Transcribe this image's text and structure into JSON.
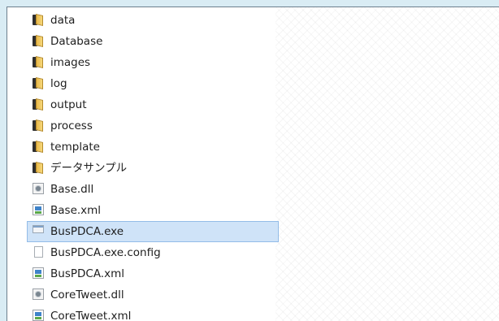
{
  "file_list": {
    "items": [
      {
        "name": "data",
        "type": "folder",
        "icon": "folder-icon"
      },
      {
        "name": "Database",
        "type": "folder",
        "icon": "folder-icon"
      },
      {
        "name": "images",
        "type": "folder",
        "icon": "folder-icon"
      },
      {
        "name": "log",
        "type": "folder",
        "icon": "folder-icon"
      },
      {
        "name": "output",
        "type": "folder",
        "icon": "folder-icon"
      },
      {
        "name": "process",
        "type": "folder",
        "icon": "folder-icon"
      },
      {
        "name": "template",
        "type": "folder",
        "icon": "folder-icon"
      },
      {
        "name": "データサンプル",
        "type": "folder",
        "icon": "folder-icon"
      },
      {
        "name": "Base.dll",
        "type": "dll",
        "icon": "dll-icon"
      },
      {
        "name": "Base.xml",
        "type": "xml",
        "icon": "xml-icon"
      },
      {
        "name": "BusPDCA.exe",
        "type": "exe",
        "icon": "exe-icon",
        "selected": true
      },
      {
        "name": "BusPDCA.exe.config",
        "type": "config",
        "icon": "file-icon"
      },
      {
        "name": "BusPDCA.xml",
        "type": "xml",
        "icon": "xml-icon"
      },
      {
        "name": "CoreTweet.dll",
        "type": "dll",
        "icon": "dll-icon"
      },
      {
        "name": "CoreTweet.xml",
        "type": "xml",
        "icon": "xml-icon"
      }
    ]
  },
  "colors": {
    "window_background": "#d9ecf4",
    "pane_background": "#ffffff",
    "selection_fill": "#cfe3f8",
    "selection_border": "#93bce8",
    "folder_yellow": "#f6d77a"
  }
}
